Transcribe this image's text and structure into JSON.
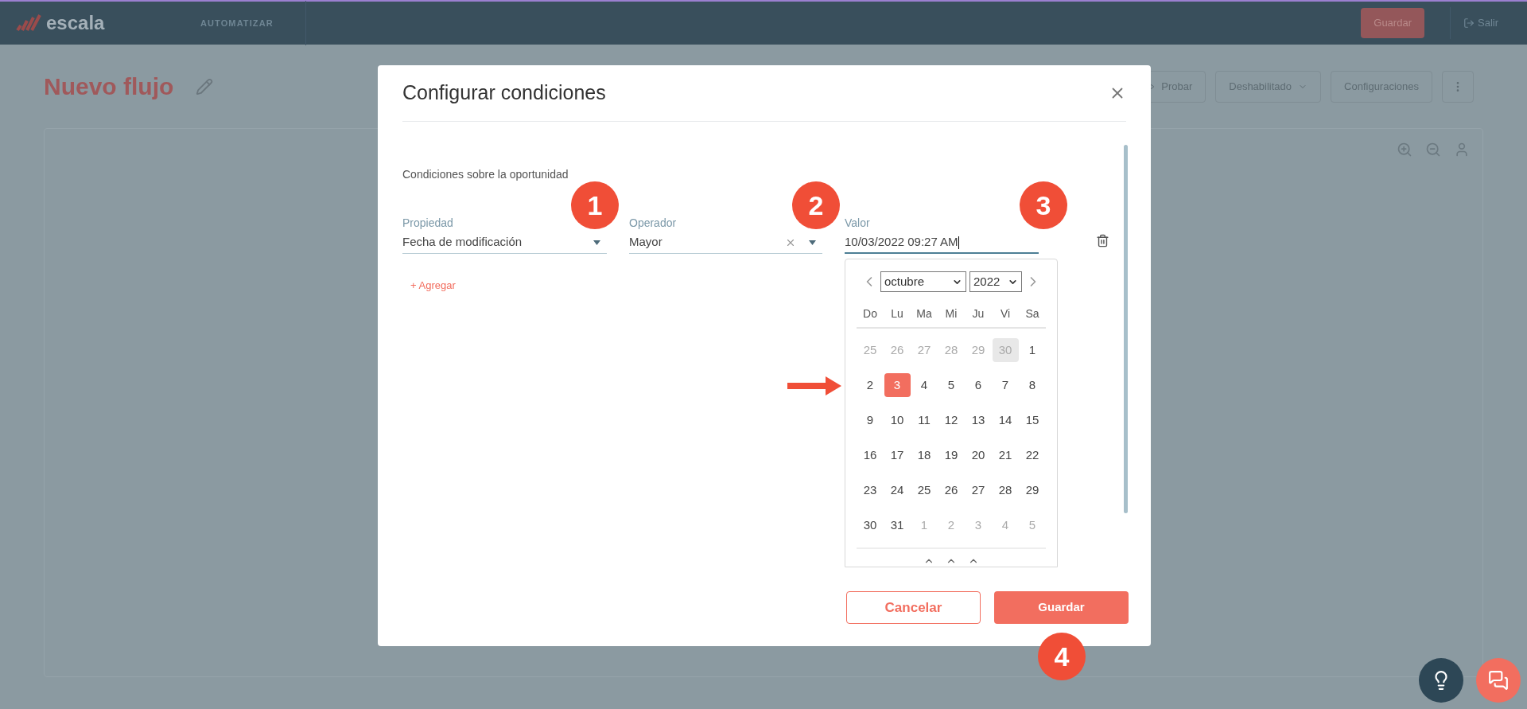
{
  "app_bar": {
    "logo": "escala",
    "nav": "AUTOMATIZAR",
    "save_button": "Guardar",
    "exit": "Salir"
  },
  "page": {
    "title": "Nuevo flujo",
    "toolbar": [
      {
        "label": "Probar",
        "kind": "play"
      },
      {
        "label": "Deshabilitado",
        "kind": "dropdown"
      },
      {
        "label": "Configuraciones",
        "kind": "plain"
      }
    ]
  },
  "modal": {
    "title": "Configurar condiciones",
    "section_label": "Condiciones sobre la oportunidad",
    "fields": [
      {
        "label": "Propiedad",
        "value": "Fecha de modificación",
        "clearable": false,
        "focused": false
      },
      {
        "label": "Operador",
        "value": "Mayor",
        "clearable": true,
        "focused": false
      },
      {
        "label": "Valor",
        "value": "10/03/2022 09:27 AM",
        "clearable": false,
        "focused": true
      }
    ],
    "add_link": "+ Agregar",
    "date_picker": {
      "month": "octubre",
      "year": "2022",
      "weekdays": [
        "Do",
        "Lu",
        "Ma",
        "Mi",
        "Ju",
        "Vi",
        "Sa"
      ],
      "weeks": [
        [
          {
            "day": "25",
            "outside": true,
            "selected": false,
            "highlighted": false
          },
          {
            "day": "26",
            "outside": true,
            "selected": false,
            "highlighted": false
          },
          {
            "day": "27",
            "outside": true,
            "selected": false,
            "highlighted": false
          },
          {
            "day": "28",
            "outside": true,
            "selected": false,
            "highlighted": false
          },
          {
            "day": "29",
            "outside": true,
            "selected": false,
            "highlighted": false
          },
          {
            "day": "30",
            "outside": true,
            "selected": false,
            "highlighted": true
          },
          {
            "day": "1",
            "outside": false,
            "selected": false,
            "highlighted": false
          }
        ],
        [
          {
            "day": "2",
            "outside": false,
            "selected": false,
            "highlighted": false
          },
          {
            "day": "3",
            "outside": false,
            "selected": true,
            "highlighted": false
          },
          {
            "day": "4",
            "outside": false,
            "selected": false,
            "highlighted": false
          },
          {
            "day": "5",
            "outside": false,
            "selected": false,
            "highlighted": false
          },
          {
            "day": "6",
            "outside": false,
            "selected": false,
            "highlighted": false
          },
          {
            "day": "7",
            "outside": false,
            "selected": false,
            "highlighted": false
          },
          {
            "day": "8",
            "outside": false,
            "selected": false,
            "highlighted": false
          }
        ],
        [
          {
            "day": "9",
            "outside": false,
            "selected": false,
            "highlighted": false
          },
          {
            "day": "10",
            "outside": false,
            "selected": false,
            "highlighted": false
          },
          {
            "day": "11",
            "outside": false,
            "selected": false,
            "highlighted": false
          },
          {
            "day": "12",
            "outside": false,
            "selected": false,
            "highlighted": false
          },
          {
            "day": "13",
            "outside": false,
            "selected": false,
            "highlighted": false
          },
          {
            "day": "14",
            "outside": false,
            "selected": false,
            "highlighted": false
          },
          {
            "day": "15",
            "outside": false,
            "selected": false,
            "highlighted": false
          }
        ],
        [
          {
            "day": "16",
            "outside": false,
            "selected": false,
            "highlighted": false
          },
          {
            "day": "17",
            "outside": false,
            "selected": false,
            "highlighted": false
          },
          {
            "day": "18",
            "outside": false,
            "selected": false,
            "highlighted": false
          },
          {
            "day": "19",
            "outside": false,
            "selected": false,
            "highlighted": false
          },
          {
            "day": "20",
            "outside": false,
            "selected": false,
            "highlighted": false
          },
          {
            "day": "21",
            "outside": false,
            "selected": false,
            "highlighted": false
          },
          {
            "day": "22",
            "outside": false,
            "selected": false,
            "highlighted": false
          }
        ],
        [
          {
            "day": "23",
            "outside": false,
            "selected": false,
            "highlighted": false
          },
          {
            "day": "24",
            "outside": false,
            "selected": false,
            "highlighted": false
          },
          {
            "day": "25",
            "outside": false,
            "selected": false,
            "highlighted": false
          },
          {
            "day": "26",
            "outside": false,
            "selected": false,
            "highlighted": false
          },
          {
            "day": "27",
            "outside": false,
            "selected": false,
            "highlighted": false
          },
          {
            "day": "28",
            "outside": false,
            "selected": false,
            "highlighted": false
          },
          {
            "day": "29",
            "outside": false,
            "selected": false,
            "highlighted": false
          }
        ],
        [
          {
            "day": "30",
            "outside": false,
            "selected": false,
            "highlighted": false
          },
          {
            "day": "31",
            "outside": false,
            "selected": false,
            "highlighted": false
          },
          {
            "day": "1",
            "outside": true,
            "selected": false,
            "highlighted": false
          },
          {
            "day": "2",
            "outside": true,
            "selected": false,
            "highlighted": false
          },
          {
            "day": "3",
            "outside": true,
            "selected": false,
            "highlighted": false
          },
          {
            "day": "4",
            "outside": true,
            "selected": false,
            "highlighted": false
          },
          {
            "day": "5",
            "outside": true,
            "selected": false,
            "highlighted": false
          }
        ]
      ]
    },
    "cancel_button": "Cancelar",
    "save_button": "Guardar"
  },
  "annotations": [
    "1",
    "2",
    "3",
    "4"
  ]
}
